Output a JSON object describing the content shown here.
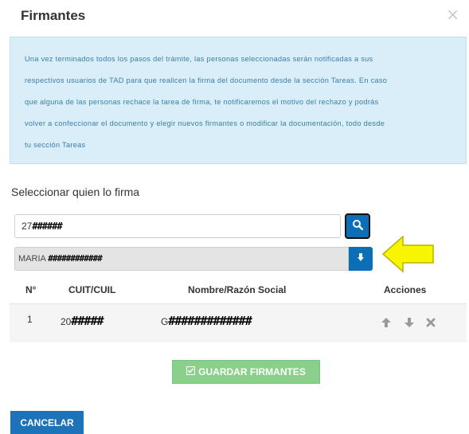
{
  "modal": {
    "title": "Firmantes",
    "close_glyph": "×"
  },
  "info": {
    "lines": [
      "Una vez terminados todos los pasos del trámite, las personas seleccionadas serán notificadas a sus",
      "respectivos usuarios de TAD para que realicen la firma del documento desde la sección Tareas. En caso",
      "que alguna de las personas rechace la tarea de firma, te notificaremos el motivo del rechazo y podrás",
      "volver a confeccionar el documento y elegir nuevos firmantes o modificar la documentación, todo desde",
      "tu sección Tareas"
    ]
  },
  "signer_select": {
    "section_title": "Seleccionar quien lo firma",
    "search_value_prefix": "27",
    "search_value_redacted": "######",
    "search_icon": "search-icon",
    "select_value_prefix": "MARIA",
    "select_value_redacted": "############",
    "add_icon": "arrow-down-icon"
  },
  "table": {
    "headers": [
      "N°",
      "CUIT/CUIL",
      "Nombre/Razón Social",
      "Acciones"
    ],
    "rows": [
      {
        "number": "1",
        "cuit_prefix": "20",
        "cuit_redacted": "#####",
        "name_prefix": "G",
        "name_redacted": "#############"
      }
    ]
  },
  "buttons": {
    "save_label": "GUARDAR FIRMANTES",
    "cancel_label": "CANCELAR"
  },
  "colors": {
    "primary": "#0d6eb8",
    "info_bg": "#d9eef9",
    "info_text": "#3a7ea7",
    "save_disabled": "#8ad08a",
    "callout_arrow": "#f7f500"
  }
}
